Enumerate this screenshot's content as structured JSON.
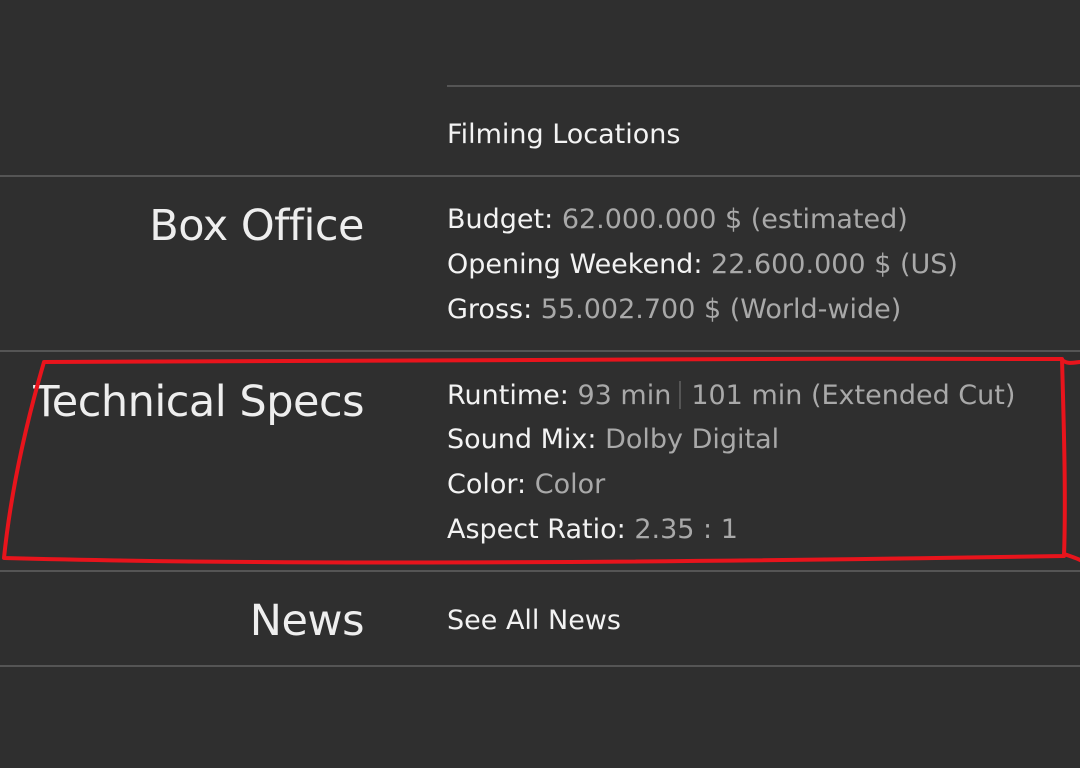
{
  "filming": {
    "label": "Filming Locations"
  },
  "box_office": {
    "title": "Box Office",
    "budget": {
      "label": "Budget:",
      "value": "62.000.000 $ (estimated)"
    },
    "opening": {
      "label": "Opening Weekend:",
      "value": "22.600.000 $ (US)"
    },
    "gross": {
      "label": "Gross:",
      "value": "55.002.700 $ (World-wide)"
    }
  },
  "technical_specs": {
    "title": "Technical Specs",
    "runtime": {
      "label": "Runtime:",
      "value_1": "93 min",
      "value_2": "101 min (Extended Cut)"
    },
    "sound_mix": {
      "label": "Sound Mix:",
      "value": "Dolby Digital"
    },
    "color": {
      "label": "Color:",
      "value": "Color"
    },
    "aspect_ratio": {
      "label": "Aspect Ratio:",
      "value": "2.35 : 1"
    }
  },
  "news": {
    "title": "News",
    "link": "See All News"
  },
  "colors": {
    "background": "#2f2f2f",
    "divider": "#555555",
    "label_text": "#f3f3f3",
    "value_text": "#a9a9a9",
    "annotation": "#e8141c"
  }
}
